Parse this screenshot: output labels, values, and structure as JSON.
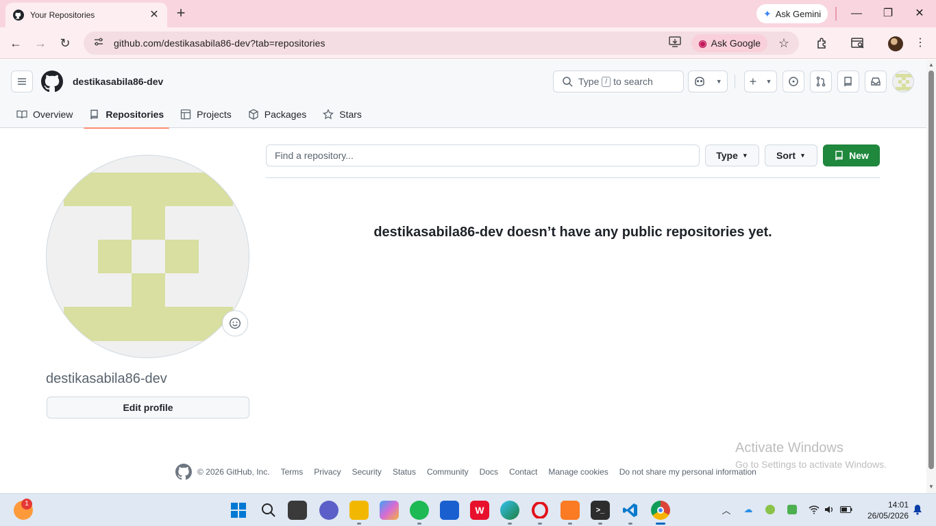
{
  "browser": {
    "tab_title": "Your Repositories",
    "url": "github.com/destikasabila86-dev?tab=repositories",
    "ask_gemini": "Ask Gemini",
    "ask_google": "Ask Google"
  },
  "header": {
    "username": "destikasabila86-dev",
    "search_prefix": "Type",
    "search_key": "/",
    "search_suffix": "to search"
  },
  "nav": {
    "tabs": [
      {
        "label": "Overview",
        "icon": "book-icon"
      },
      {
        "label": "Repositories",
        "icon": "repo-icon",
        "selected": true
      },
      {
        "label": "Projects",
        "icon": "table-icon"
      },
      {
        "label": "Packages",
        "icon": "package-icon"
      },
      {
        "label": "Stars",
        "icon": "star-icon"
      }
    ]
  },
  "profile": {
    "name": "destikasabila86-dev",
    "edit_label": "Edit profile",
    "identicon_color": "#d8dfa0"
  },
  "repos": {
    "search_placeholder": "Find a repository...",
    "type_label": "Type",
    "sort_label": "Sort",
    "new_label": "New",
    "empty_message": "destikasabila86-dev doesn’t have any public repositories yet."
  },
  "footer": {
    "copyright": "© 2026 GitHub, Inc.",
    "links": [
      "Terms",
      "Privacy",
      "Security",
      "Status",
      "Community",
      "Docs",
      "Contact",
      "Manage cookies",
      "Do not share my personal information"
    ]
  },
  "watermark": {
    "line1": "Activate Windows",
    "line2": "Go to Settings to activate Windows."
  },
  "taskbar": {
    "weather_badge": "1",
    "time": "14:01",
    "date": "26/05/2026"
  }
}
